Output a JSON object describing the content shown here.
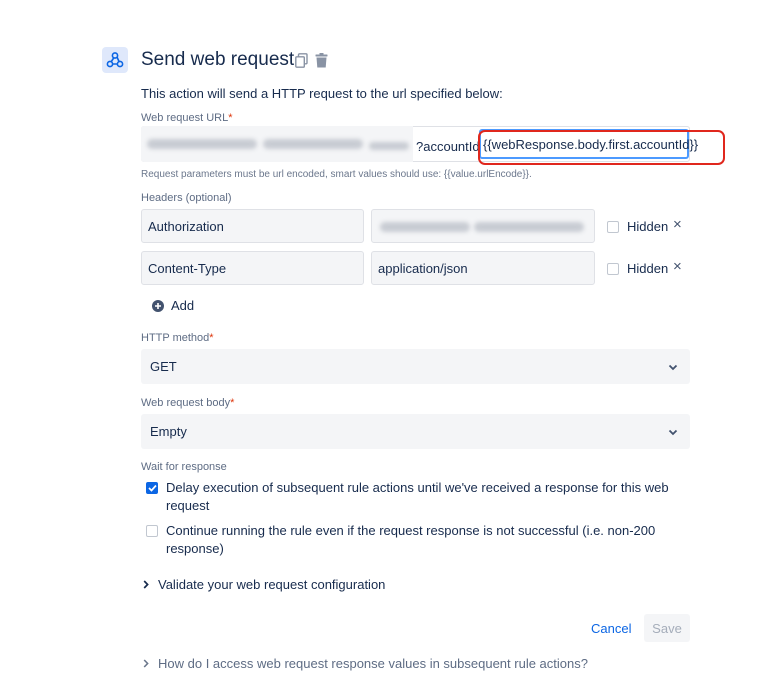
{
  "header": {
    "title": "Send web request",
    "icon": "webhook-icon",
    "accent": "#0c66e4"
  },
  "description": "This action will send a HTTP request to the url specified below:",
  "url_field": {
    "label": "Web request URL",
    "required_mark": "*",
    "visible_prefix": "?accountId=",
    "value_fragment": "{{webResponse.body.first.accountId}}",
    "hint": "Request parameters must be url encoded, smart values should use: {{value.urlEncode}}."
  },
  "headers": {
    "label": "Headers (optional)",
    "rows": [
      {
        "name": "Authorization",
        "value": "",
        "hidden_label": "Hidden",
        "hidden_checked": false,
        "remove": "×"
      },
      {
        "name": "Content-Type",
        "value": "application/json",
        "hidden_label": "Hidden",
        "hidden_checked": false,
        "remove": "×"
      }
    ],
    "add_label": "Add"
  },
  "http_method": {
    "label": "HTTP method",
    "required_mark": "*",
    "selected": "GET"
  },
  "request_body": {
    "label": "Web request body",
    "required_mark": "*",
    "selected": "Empty"
  },
  "wait": {
    "label": "Wait for response",
    "options": [
      {
        "line1": "Delay execution of subsequent rule actions until we've received a response for this web",
        "line2": "request",
        "checked": true
      },
      {
        "line1": "Continue running the rule even if the request response is not successful (i.e. non-200",
        "line2": "response)",
        "checked": false
      }
    ]
  },
  "validate_label": "Validate your web request configuration",
  "actions": {
    "cancel_label": "Cancel",
    "save_label": "Save"
  },
  "help_link": "How do I access web request response values in subsequent rule actions?",
  "colors": {
    "annotation": "#e0271d",
    "focus": "#4c9aff",
    "link": "#0c66e4"
  }
}
